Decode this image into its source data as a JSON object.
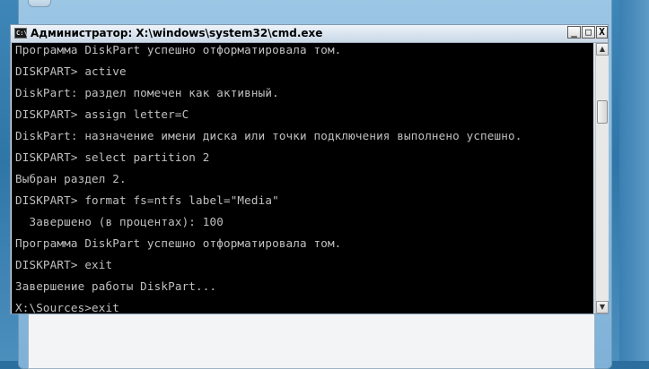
{
  "window": {
    "title": "Администратор: X:\\windows\\system32\\cmd.exe",
    "icon_label": "C:\\",
    "minimize_glyph": "_",
    "maximize_glyph": "□",
    "close_glyph": "X"
  },
  "console": {
    "lines": [
      "Программа DiskPart успешно отформатировала том.",
      "",
      "DISKPART> active",
      "",
      "DiskPart: раздел помечен как активный.",
      "",
      "DISKPART> assign letter=C",
      "",
      "DiskPart: назначение имени диска или точки подключения выполнено успешно.",
      "",
      "DISKPART> select partition 2",
      "",
      "Выбран раздел 2.",
      "",
      "DISKPART> format fs=ntfs label=\"Media\"",
      "",
      "  Завершено (в процентах): 100",
      "",
      "Программа DiskPart успешно отформатировала том.",
      "",
      "DISKPART> exit",
      "",
      "Завершение работы DiskPart...",
      "",
      "X:\\Sources>exit"
    ]
  },
  "scrollbar": {
    "up_glyph": "▲",
    "down_glyph": "▼"
  }
}
